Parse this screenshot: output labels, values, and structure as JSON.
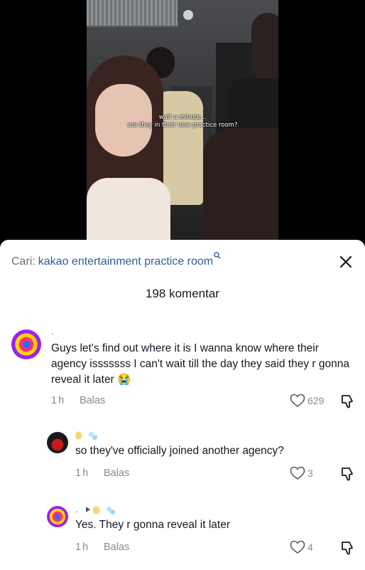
{
  "video": {
    "caption_line1": "wait a minute...",
    "caption_line2": "are they in their new practice room?"
  },
  "search": {
    "prefix": "Cari:",
    "query": "kakao entertainment practice room"
  },
  "comments_header": {
    "count_label": "198 komentar"
  },
  "comments": [
    {
      "username": ".",
      "text": "Guys let's find out where it is I wanna know where their agency isssssss I can't wait till the day they said they r gonna reveal it later 😭",
      "time": "1h",
      "reply_label": "Balas",
      "likes": "629"
    },
    {
      "username": "",
      "text": "so they've officially joined another agency?",
      "time": "1h",
      "reply_label": "Balas",
      "likes": "3"
    },
    {
      "username": ".",
      "text": "Yes. They r gonna reveal it later",
      "time": "1h",
      "reply_label": "Balas",
      "likes": "4"
    }
  ],
  "colors": {
    "query_blue": "#2e5c9b",
    "meta_gray": "#8a8b91",
    "text_dark": "#161823"
  },
  "icons": [
    "search-icon",
    "close-icon",
    "heart-icon",
    "dislike-icon",
    "play-arrow-icon",
    "moon-emoji-icon",
    "bubbles-emoji-icon"
  ]
}
